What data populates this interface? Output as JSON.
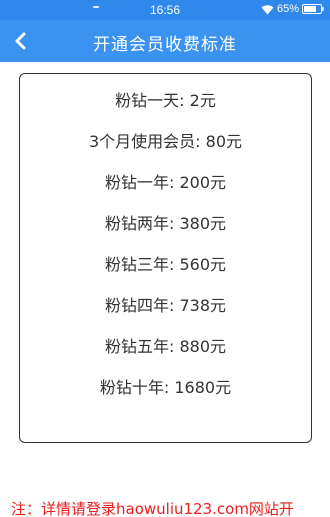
{
  "status_bar": {
    "time": "16:56",
    "battery": "65%"
  },
  "header": {
    "title": "开通会员收费标准",
    "back_icon": "chevron-left-icon"
  },
  "price_list": [
    "粉钻一天: 2元",
    "3个月使用会员: 80元",
    "粉钻一年: 200元",
    "粉钻两年: 380元",
    "粉钻三年: 560元",
    "粉钻四年: 738元",
    "粉钻五年: 880元",
    "粉钻十年: 1680元"
  ],
  "footer": {
    "note": "注：详情请登录haowuliu123.com网站开"
  },
  "colors": {
    "header": "#3a93f0",
    "status_bar": "#2f89ec",
    "note": "#ee1d1d",
    "text": "#333333"
  }
}
